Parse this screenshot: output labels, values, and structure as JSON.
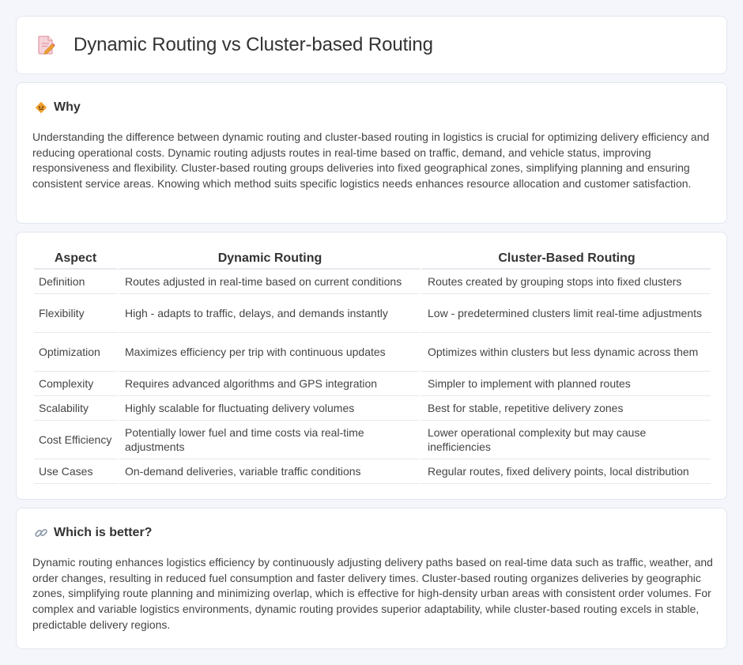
{
  "header": {
    "title": "Dynamic Routing vs Cluster-based Routing",
    "icon": "document-edit-icon"
  },
  "why": {
    "icon": "diamond-warning-icon",
    "title": "Why",
    "body": "Understanding the difference between dynamic routing and cluster-based routing in logistics is crucial for optimizing delivery efficiency and reducing operational costs. Dynamic routing adjusts routes in real-time based on traffic, demand, and vehicle status, improving responsiveness and flexibility. Cluster-based routing groups deliveries into fixed geographical zones, simplifying planning and ensuring consistent service areas. Knowing which method suits specific logistics needs enhances resource allocation and customer satisfaction."
  },
  "comparison": {
    "headers": [
      "Aspect",
      "Dynamic Routing",
      "Cluster-Based Routing"
    ],
    "rows": [
      [
        "Definition",
        "Routes adjusted in real-time based on current conditions",
        "Routes created by grouping stops into fixed clusters"
      ],
      [
        "Flexibility",
        "High - adapts to traffic, delays, and demands instantly",
        "Low - predetermined clusters limit real-time adjustments"
      ],
      [
        "Optimization",
        "Maximizes efficiency per trip with continuous updates",
        "Optimizes within clusters but less dynamic across them"
      ],
      [
        "Complexity",
        "Requires advanced algorithms and GPS integration",
        "Simpler to implement with planned routes"
      ],
      [
        "Scalability",
        "Highly scalable for fluctuating delivery volumes",
        "Best for stable, repetitive delivery zones"
      ],
      [
        "Cost Efficiency",
        "Potentially lower fuel and time costs via real-time adjustments",
        "Lower operational complexity but may cause inefficiencies"
      ],
      [
        "Use Cases",
        "On-demand deliveries, variable traffic conditions",
        "Regular routes, fixed delivery points, local distribution"
      ]
    ]
  },
  "better": {
    "icon": "link-icon",
    "title": "Which is better?",
    "body": "Dynamic routing enhances logistics efficiency by continuously adjusting delivery paths based on real-time data such as traffic, weather, and order changes, resulting in reduced fuel consumption and faster delivery times. Cluster-based routing organizes deliveries by geographic zones, simplifying route planning and minimizing overlap, which is effective for high-density urban areas with consistent order volumes. For complex and variable logistics environments, dynamic routing provides superior adaptability, while cluster-based routing excels in stable, predictable delivery regions."
  },
  "colors": {
    "background": "#f4f6fb",
    "card": "#ffffff",
    "border": "#e2e6ef",
    "icon_orange": "#f0a030",
    "icon_pink": "#e9a0a8"
  }
}
